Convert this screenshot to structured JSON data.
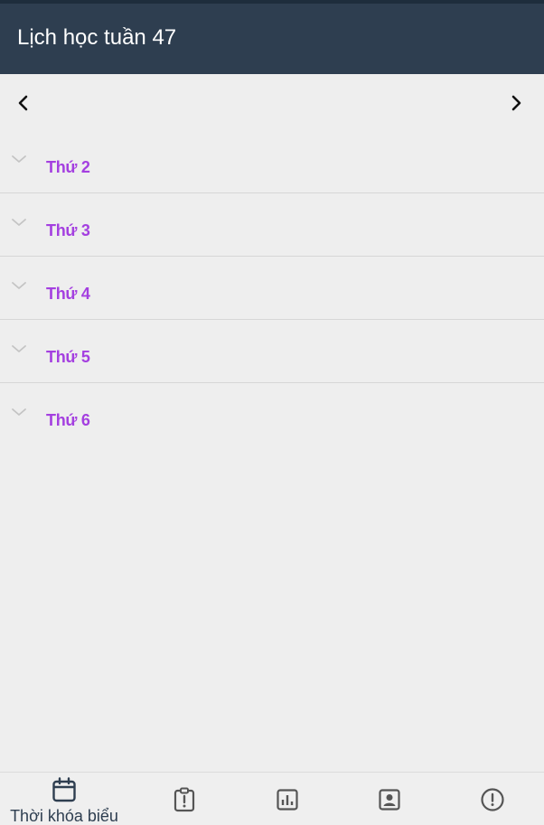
{
  "header": {
    "title": "Lịch học tuần 47"
  },
  "week_nav": {
    "prev_icon": "chevron-left-icon",
    "next_icon": "chevron-right-icon"
  },
  "days": [
    {
      "label": "Thứ 2"
    },
    {
      "label": "Thứ 3"
    },
    {
      "label": "Thứ 4"
    },
    {
      "label": "Thứ 5"
    },
    {
      "label": "Thứ 6"
    }
  ],
  "bottom_nav": {
    "tabs": [
      {
        "label": "Thời khóa biểu",
        "icon": "calendar-icon",
        "active": true
      },
      {
        "label": "",
        "icon": "clipboard-alert-icon",
        "active": false
      },
      {
        "label": "",
        "icon": "bar-chart-icon",
        "active": false
      },
      {
        "label": "",
        "icon": "contact-card-icon",
        "active": false
      },
      {
        "label": "",
        "icon": "alert-circle-icon",
        "active": false
      }
    ]
  },
  "colors": {
    "appbar": "#2e3e50",
    "day_label": "#a43fe0",
    "background": "#eeeeee"
  }
}
